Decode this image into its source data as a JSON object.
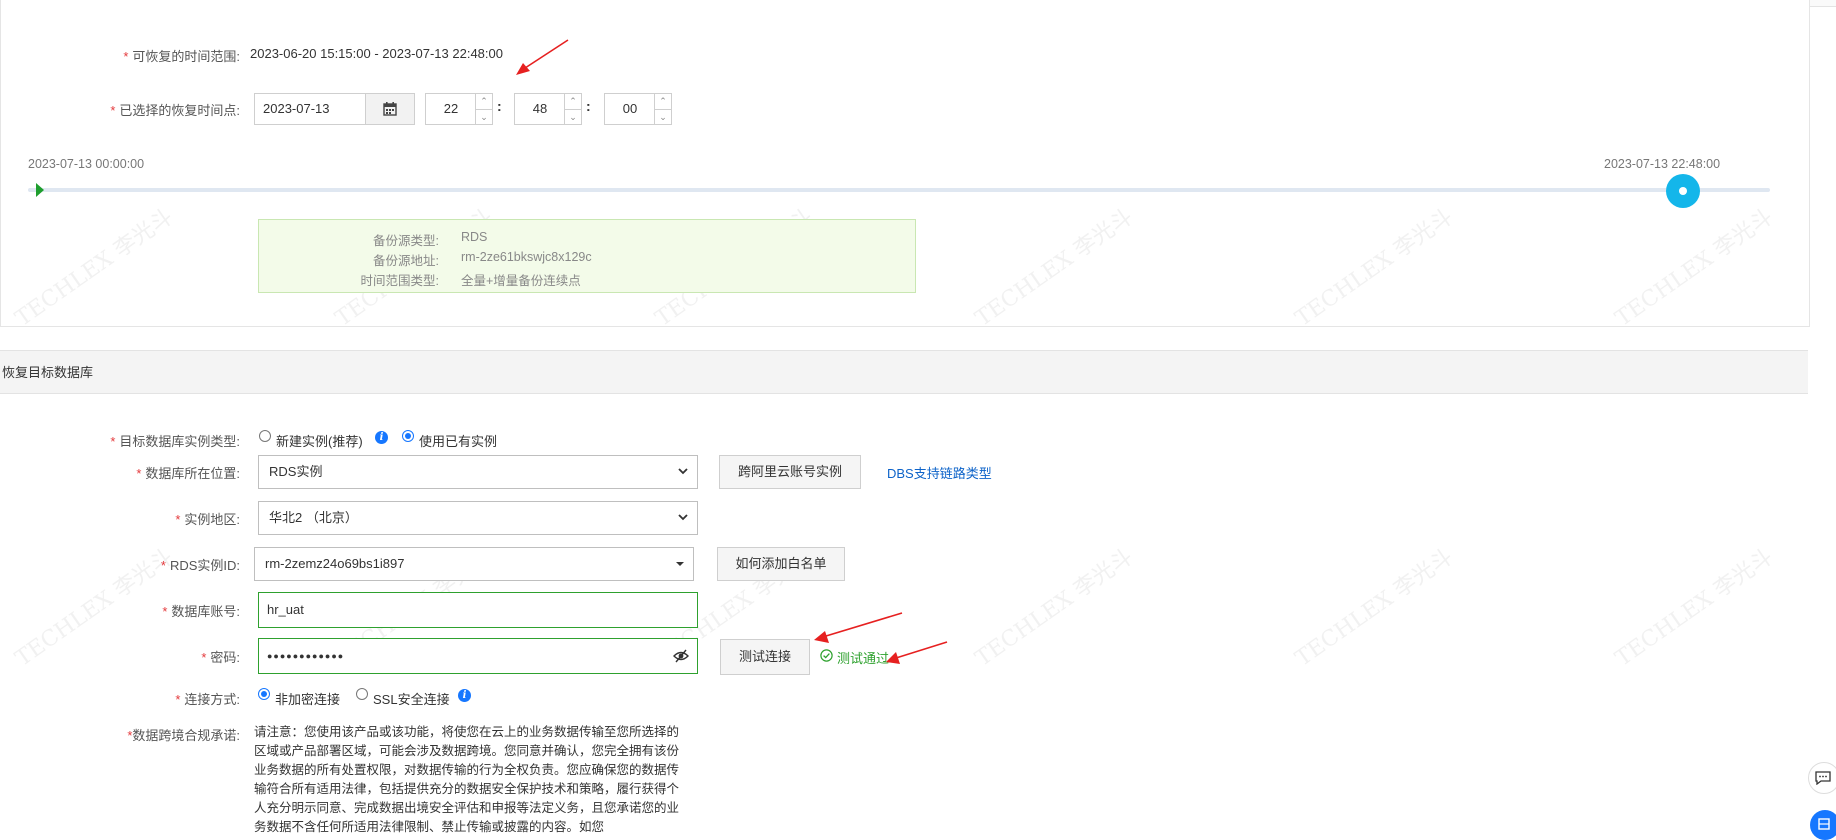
{
  "recovery": {
    "range_label": "可恢复的时间范围:",
    "range_value": "2023-06-20 15:15:00 - 2023-07-13 22:48:00",
    "point_label": "已选择的恢复时间点:",
    "date_value": "2023-07-13",
    "hour": "22",
    "minute": "48",
    "second": "00",
    "timeline_start": "2023-07-13 00:00:00",
    "timeline_end": "2023-07-13 22:48:00",
    "timeline_position": 0.95
  },
  "source_info": {
    "rows": [
      {
        "key": "备份源类型:",
        "value": "RDS"
      },
      {
        "key": "备份源地址:",
        "value": "rm-2ze61bkswjc8x129c"
      },
      {
        "key": "时间范围类型:",
        "value": "全量+增量备份连续点"
      }
    ]
  },
  "target": {
    "section_title": "恢复目标数据库",
    "instance_type_label": "目标数据库实例类型:",
    "option_new": "新建实例(推荐)",
    "option_existing": "使用已有实例",
    "location_label": "数据库所在位置:",
    "location_value": "RDS实例",
    "cross_account_btn": "跨阿里云账号实例",
    "dbs_link": "DBS支持链路类型",
    "region_label": "实例地区:",
    "region_value": "华北2 （北京）",
    "rds_id_label": "RDS实例ID:",
    "rds_id_value": "rm-2zemz24o69bs1i897",
    "whitelist_btn": "如何添加白名单",
    "account_label": "数据库账号:",
    "account_value": "hr_uat",
    "password_label": "密码:",
    "password_value": "●●●●●●●●●●●●",
    "test_btn": "测试连接",
    "test_result": "测试通过",
    "conn_label": "连接方式:",
    "conn_plain": "非加密连接",
    "conn_ssl": "SSL安全连接",
    "compliance_label": "数据跨境合规承诺:",
    "compliance_text": "请注意：您使用该产品或该功能，将使您在云上的业务数据传输至您所选择的区域或产品部署区域，可能会涉及数据跨境。您同意并确认，您完全拥有该份业务数据的所有处置权限，对数据传输的行为全权负责。您应确保您的数据传输符合所有适用法律，包括提供充分的数据安全保护技术和策略，履行获得个人充分明示同意、完成数据出境安全评估和申报等法定义务，且您承诺您的业务数据不含任何所适用法律限制、禁止传输或披露的内容。如您"
  },
  "colors": {
    "accent": "#1677ff",
    "required": "#e4393c",
    "success": "#2ea12e",
    "knob": "#14b6ea",
    "link": "#0d63c9"
  },
  "watermark": {
    "text": "TECHLEX 李光斗"
  }
}
